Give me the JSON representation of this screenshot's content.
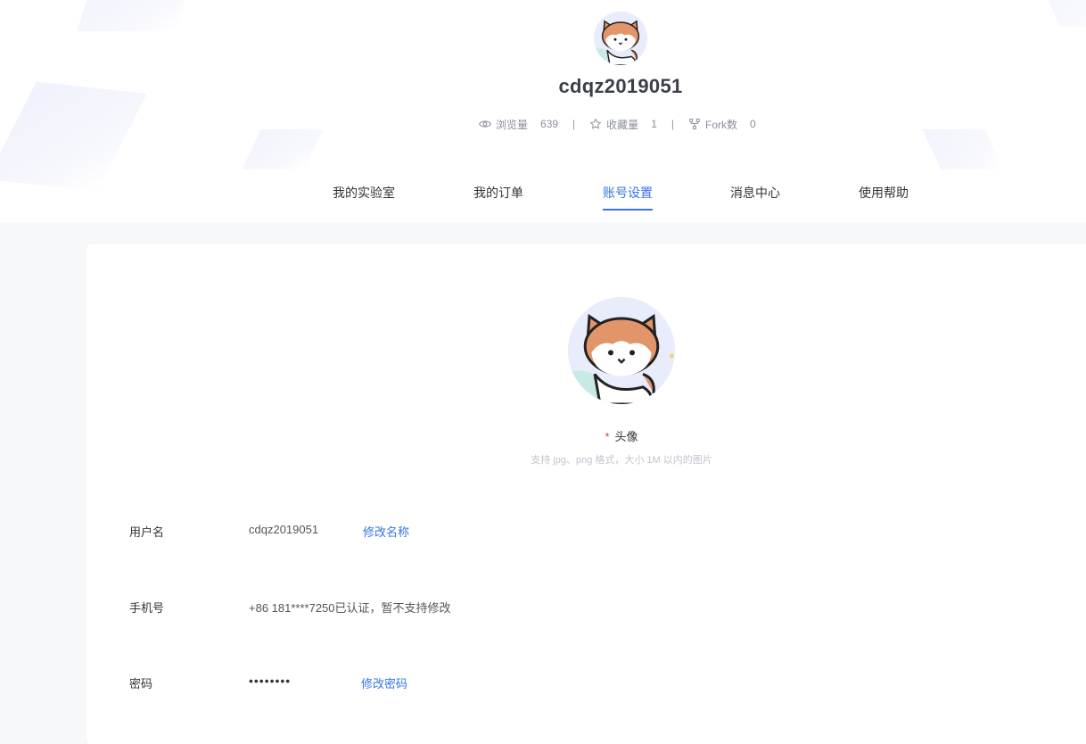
{
  "profile": {
    "username": "cdqz2019051",
    "stats": [
      {
        "icon": "eye-icon",
        "label": "浏览量",
        "value": "639"
      },
      {
        "icon": "star-icon",
        "label": "收藏量",
        "value": "1"
      },
      {
        "icon": "fork-icon",
        "label": "Fork数",
        "value": "0"
      }
    ],
    "separator": "|"
  },
  "tabs": [
    {
      "label": "我的实验室",
      "active": false
    },
    {
      "label": "我的订单",
      "active": false
    },
    {
      "label": "账号设置",
      "active": true
    },
    {
      "label": "消息中心",
      "active": false
    },
    {
      "label": "使用帮助",
      "active": false
    }
  ],
  "settings": {
    "avatar": {
      "required_mark": "*",
      "label": "头像",
      "hint": "支持 jpg、png 格式，大小 1M 以内的图片"
    },
    "username_row": {
      "label": "用户名",
      "value": "cdqz2019051",
      "action": "修改名称"
    },
    "phone_row": {
      "label": "手机号",
      "value": "+86 181****7250已认证，暂不支持修改"
    },
    "password_row": {
      "label": "密码",
      "value": "••••••••",
      "action": "修改密码"
    }
  },
  "colors": {
    "accent": "#3574e3",
    "required": "#e4393c",
    "page_bg": "#f7f8fa"
  }
}
